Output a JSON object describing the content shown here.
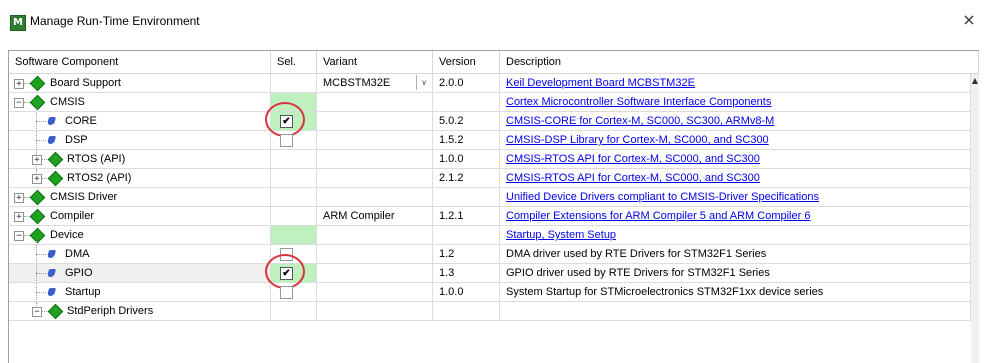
{
  "window": {
    "title": "Manage Run-Time Environment",
    "close_glyph": "×",
    "app_icon_letter": "M"
  },
  "columns": {
    "component": "Software Component",
    "sel": "Sel.",
    "variant": "Variant",
    "version": "Version",
    "description": "Description"
  },
  "rows": [
    {
      "name": "Board Support",
      "variant": "MCBSTM32E",
      "version": "2.0.0",
      "description": "Keil Development Board MCBSTM32E"
    },
    {
      "name": "CMSIS",
      "variant": "",
      "version": "",
      "description": "Cortex Microcontroller Software Interface Components"
    },
    {
      "name": "CORE",
      "variant": "",
      "version": "5.0.2",
      "description": "CMSIS-CORE for Cortex-M, SC000, SC300, ARMv8-M"
    },
    {
      "name": "DSP",
      "variant": "",
      "version": "1.5.2",
      "description": "CMSIS-DSP Library for Cortex-M, SC000, and SC300"
    },
    {
      "name": "RTOS (API)",
      "variant": "",
      "version": "1.0.0",
      "description": "CMSIS-RTOS API for Cortex-M, SC000, and SC300"
    },
    {
      "name": "RTOS2 (API)",
      "variant": "",
      "version": "2.1.2",
      "description": "CMSIS-RTOS API for Cortex-M, SC000, and SC300"
    },
    {
      "name": "CMSIS Driver",
      "variant": "",
      "version": "",
      "description": "Unified Device Drivers compliant to CMSIS-Driver Specifications"
    },
    {
      "name": "Compiler",
      "variant": "ARM Compiler",
      "version": "1.2.1",
      "description": "Compiler Extensions for ARM Compiler 5 and ARM Compiler 6"
    },
    {
      "name": "Device",
      "variant": "",
      "version": "",
      "description": "Startup, System Setup"
    },
    {
      "name": "DMA",
      "variant": "",
      "version": "1.2",
      "description": "DMA driver used by RTE Drivers for STM32F1 Series"
    },
    {
      "name": "GPIO",
      "variant": "",
      "version": "1.3",
      "description": "GPIO driver used by RTE Drivers for STM32F1 Series"
    },
    {
      "name": "Startup",
      "variant": "",
      "version": "1.0.0",
      "description": "System Startup for STMicroelectronics STM32F1xx device series"
    },
    {
      "name": "StdPeriph Drivers",
      "variant": "",
      "version": "",
      "description": ""
    }
  ],
  "glyphs": {
    "plus": "+",
    "minus": "−",
    "check": "✔",
    "dropdown": "∨",
    "scroll_up": "▲"
  },
  "colors": {
    "selection_green": "#bff0bf",
    "link": "#0000ee",
    "highlight_circle": "#d9323a",
    "component_green": "#1fa21f",
    "component_blue": "#3a5fcd"
  }
}
